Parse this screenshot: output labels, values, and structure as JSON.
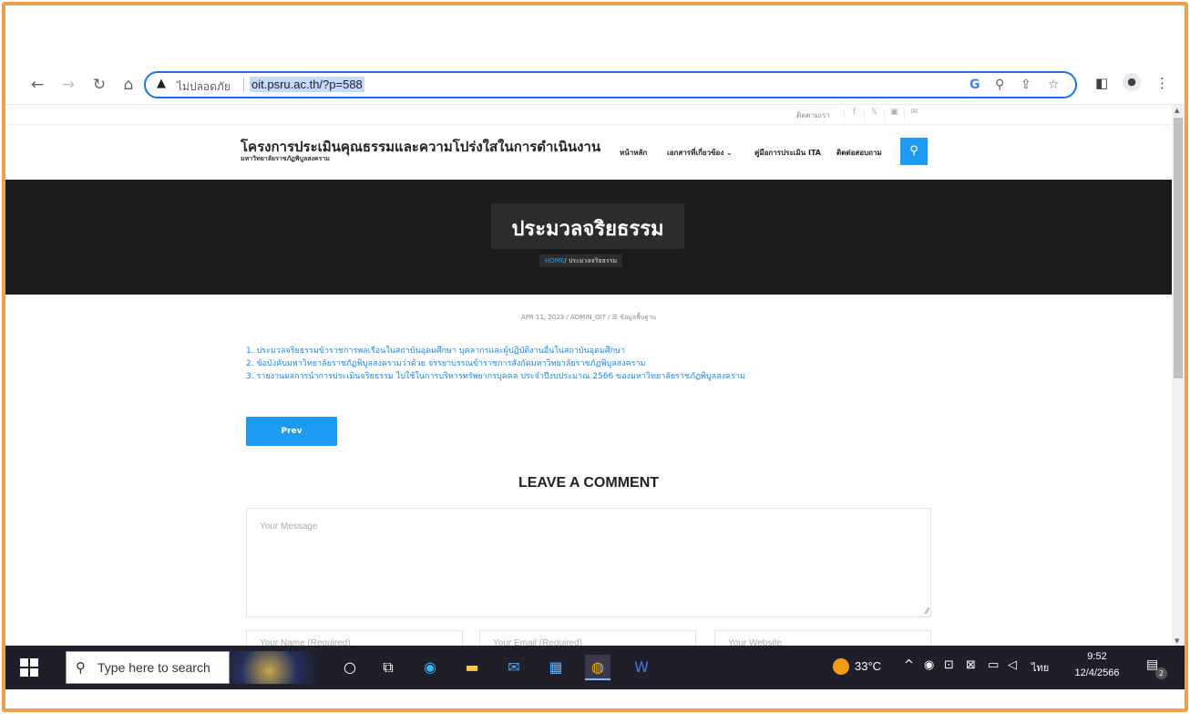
{
  "browser": {
    "status_text": "ไม่ปลอดภัย",
    "url": "oit.psru.ac.th/?p=588"
  },
  "topbar": {
    "contact": "ติดตามเรา",
    "social": [
      "f",
      "𝕏",
      "▣",
      "✉"
    ]
  },
  "header": {
    "site_title": "โครงการประเมินคุณธรรมและความโปร่งใสในการดำเนินงาน",
    "site_subtitle": "มหาวิทยาลัยราชภัฏพิบูลสงคราม",
    "menu": [
      "หน้าหลัก",
      "เอกสารที่เกี่ยวข้อง ⌄",
      "คู่มือการประเมิน ITA",
      "ติดต่อสอบถาม"
    ]
  },
  "hero": {
    "title": "ประมวลจริยธรรม",
    "breadcrumb_home": "HOME",
    "breadcrumb_current": "/ ประมวลจริยธรรม"
  },
  "post": {
    "meta": "APR 11, 2023  /  ADMIN_OIT  /  ☰  ข้อมูลพื้นฐาน",
    "lines": [
      "1. ประมวลจริยธรรมข้าราชการพลเรือนในสถาบันอุดมศึกษา บุคลากรและผู้ปฏิบัติงานอื่นในสถาบันอุดมศึกษา",
      "2. ข้อบังคับมหาวิทยาลัยราชภัฏพิบูลสงครามว่าด้วย จรรยาบรรณข้าราชการสังกัดมหาวิทยาลัยราชภัฏพิบูลสงคราม",
      "3. รายงานผลการนำการประเมินจริยธรรม ไปใช้ในการบริหารทรัพยากรบุคคล ประจำปีงบประมาณ 2566 ของมหาวิทยาลัยราชภัฏพิบูลสงคราม"
    ],
    "prev_label": "Prev"
  },
  "comment": {
    "heading": "LEAVE A COMMENT",
    "message_placeholder": "Your Message",
    "name_placeholder": "Your Name (Required)",
    "email_placeholder": "Your Email (Required)",
    "website_placeholder": "Your Website"
  },
  "taskbar": {
    "search_text": "Type here to search",
    "temperature": "33°C",
    "language": "ไทย",
    "time": "9:52",
    "date": "12/4/2566",
    "notification_count": "2"
  },
  "colors": {
    "accent": "#1e9bf0",
    "frame": "#f0a04b",
    "hero_bg": "#1c1c1e"
  }
}
